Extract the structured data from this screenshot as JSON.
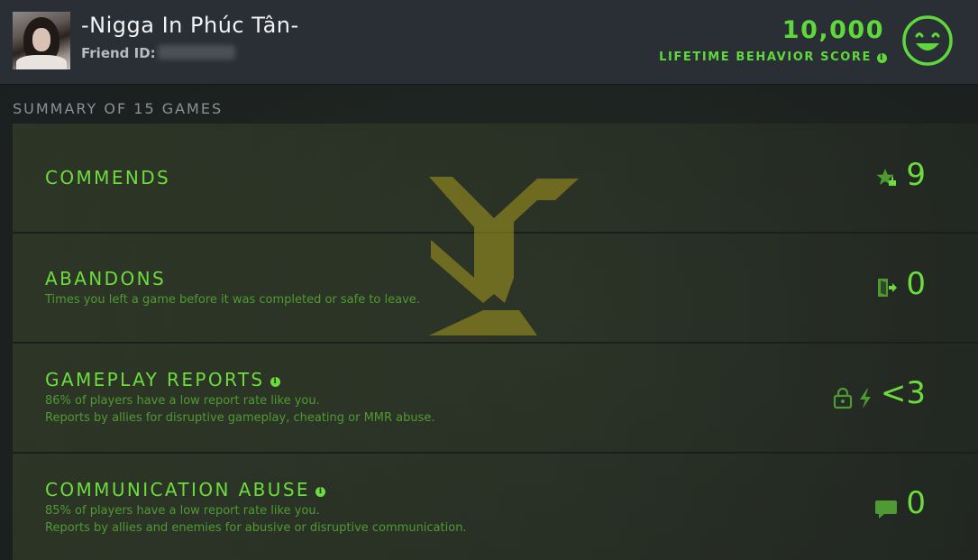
{
  "header": {
    "player_name": "-Nigga In Phúc Tân-",
    "friend_id_label": "Friend ID:",
    "score": "10,000",
    "score_label": "LIFETIME BEHAVIOR SCORE",
    "info_glyph": "i"
  },
  "summary": {
    "title": "SUMMARY OF 15 GAMES"
  },
  "rows": [
    {
      "title": "COMMENDS",
      "value": "9",
      "icon": "star-thumb-icon"
    },
    {
      "title": "ABANDONS",
      "desc1": "Times you left a game before it was completed or safe to leave.",
      "value": "0",
      "icon": "exit-door-icon"
    },
    {
      "title": "GAMEPLAY REPORTS",
      "desc1": "86% of players have a low report rate like you.",
      "desc2": "Reports by allies for disruptive gameplay, cheating or MMR abuse.",
      "value": "<3",
      "icon": "lock-bolt-icon"
    },
    {
      "title": "COMMUNICATION ABUSE",
      "desc1": "85% of players have a low report rate like you.",
      "desc2": "Reports by allies and enemies for abusive or disruptive communication.",
      "value": "0",
      "icon": "chat-bubble-icon"
    }
  ],
  "colors": {
    "accent": "#6ddd3e",
    "score": "#5fd83b",
    "header_bg": "#2a2f35"
  }
}
